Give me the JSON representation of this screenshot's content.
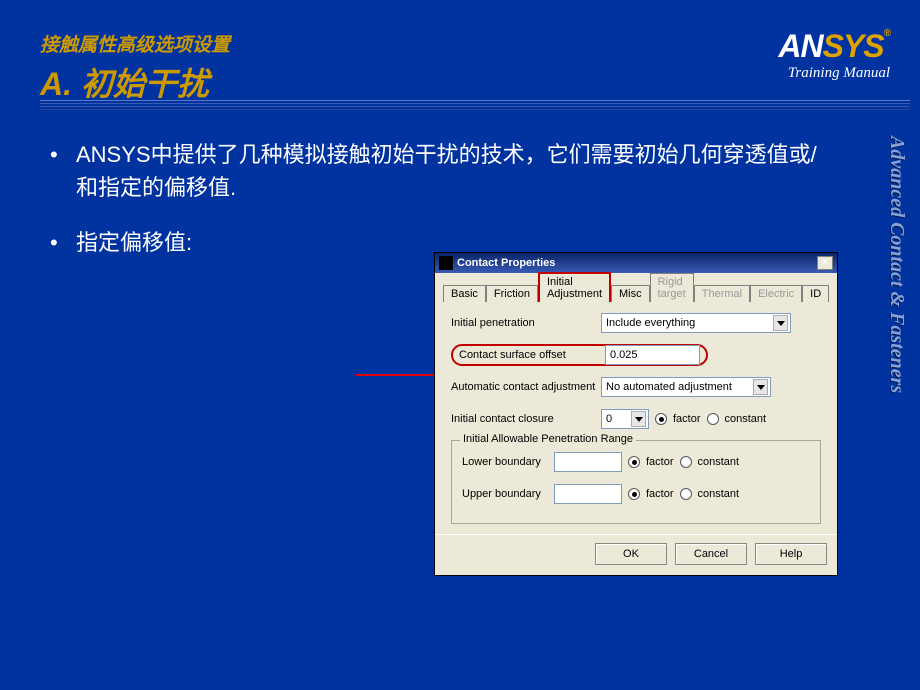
{
  "heading": {
    "sup": "接触属性高级选项设置",
    "title": "A. 初始干扰"
  },
  "logo": {
    "brand_prefix": "AN",
    "brand_suffix": "SYS",
    "reg": "®",
    "sub": "Training Manual"
  },
  "side_title": "Advanced Contact & Fasteners",
  "bullets": {
    "b1": "ANSYS中提供了几种模拟接触初始干扰的技术，它们需要初始几何穿透值或/和指定的偏移值.",
    "b2": "指定偏移值:"
  },
  "dialog": {
    "title": "Contact Properties",
    "close": "×",
    "tabs": {
      "basic": "Basic",
      "friction": "Friction",
      "initial_adjustment": "Initial Adjustment",
      "misc": "Misc",
      "rigid_target": "Rigid target",
      "thermal": "Thermal",
      "electric": "Electric",
      "id": "ID"
    },
    "fields": {
      "initial_penetration": {
        "label": "Initial penetration",
        "value": "Include everything"
      },
      "contact_surface_offset": {
        "label": "Contact surface offset",
        "value": "0.025"
      },
      "auto_adjust": {
        "label": "Automatic contact adjustment",
        "value": "No automated adjustment"
      },
      "initial_contact_closure": {
        "label": "Initial contact closure",
        "value": "0",
        "opt_factor": "factor",
        "opt_constant": "constant"
      }
    },
    "group": {
      "title": "Initial Allowable Penetration Range",
      "lower": "Lower boundary",
      "upper": "Upper boundary",
      "opt_factor": "factor",
      "opt_constant": "constant"
    },
    "buttons": {
      "ok": "OK",
      "cancel": "Cancel",
      "help": "Help"
    }
  }
}
